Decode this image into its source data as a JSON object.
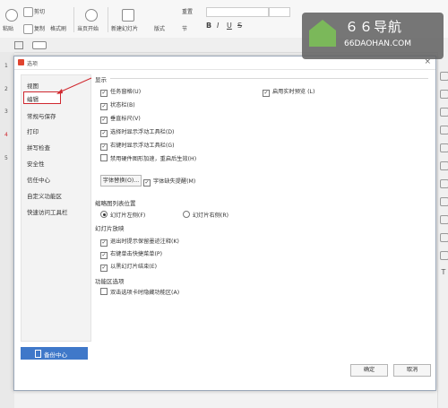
{
  "ribbon": {
    "paste": "粘贴",
    "cut": "剪切",
    "copy": "复制",
    "format_painter": "格式刷",
    "from_current": "当页开始",
    "new_slide": "新建幻灯片",
    "layout": "版式",
    "section": "节",
    "reset": "重置",
    "font_style_buttons": [
      "B",
      "I",
      "U",
      "S"
    ]
  },
  "watermark": {
    "brand": "６６导航",
    "domain": "66DAOHAN.COM"
  },
  "slide_numbers": [
    "1",
    "2",
    "3",
    "4",
    "5"
  ],
  "dialog": {
    "title": "选项",
    "close": "×",
    "nav": [
      "视图",
      "编辑",
      "常规与保存",
      "打印",
      "拼写检查",
      "安全性",
      "信任中心",
      "自定义功能区",
      "快速访问工具栏"
    ],
    "backup_button": "备份中心",
    "sections": {
      "display": {
        "title": "显示",
        "options": [
          {
            "label": "任务窗格(U)",
            "checked": true
          },
          {
            "label": "状态栏(B)",
            "checked": true
          },
          {
            "label": "垂直标尺(V)",
            "checked": true
          },
          {
            "label": "选择时显示浮动工具栏(D)",
            "checked": true
          },
          {
            "label": "右键时显示浮动工具栏(G)",
            "checked": true
          },
          {
            "label": "禁用硬件图形加速，重启后生效(H)",
            "checked": false
          }
        ],
        "right_option": {
          "label": "启用实时预览 (L)",
          "checked": true
        },
        "font_replace_button": "字体替换(O)...",
        "font_missing_option": {
          "label": "字体缺失提醒(M)",
          "checked": true
        }
      },
      "thumbnail": {
        "title": "缩略图列表位置",
        "left": "幻灯片左侧(F)",
        "right": "幻灯片右侧(R)",
        "selected": "left"
      },
      "slideshow": {
        "title": "幻灯片放映",
        "options": [
          {
            "label": "退出时提示保留墨迹注释(K)",
            "checked": true
          },
          {
            "label": "右键单击快捷菜单(P)",
            "checked": true
          },
          {
            "label": "以黑幻灯片结束(E)",
            "checked": true
          }
        ]
      },
      "ribbon_opts": {
        "title": "功能区选项",
        "options": [
          {
            "label": "双击选项卡时隐藏功能区(A)",
            "checked": false
          }
        ]
      }
    },
    "ok": "确定",
    "cancel": "取消"
  },
  "right_panel_icons": [
    "cursor-icon",
    "shape-icon",
    "animation-icon",
    "transition-icon",
    "table-icon",
    "timer-icon",
    "settings-icon",
    "sound-icon",
    "link-icon",
    "text-icon"
  ],
  "text_tool": "T",
  "colors": {
    "accent": "#3f78c9",
    "highlight": "#d0282f",
    "wps": "#e0442f"
  }
}
